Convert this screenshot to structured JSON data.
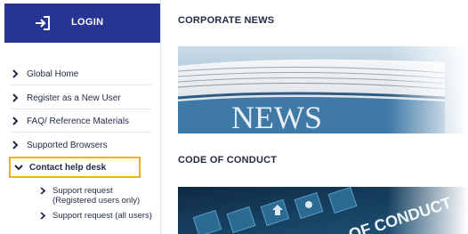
{
  "sidebar": {
    "login_label": "LOGIN",
    "items": [
      {
        "label": "Global Home"
      },
      {
        "label": "Register as a New User"
      },
      {
        "label": "FAQ/ Reference Materials"
      },
      {
        "label": "Supported Browsers"
      }
    ],
    "active_item": {
      "label": "Contact help desk"
    },
    "sub_items": [
      {
        "label": "Support request (Registered users only)"
      },
      {
        "label": "Support request (all users)"
      }
    ]
  },
  "main": {
    "sections": [
      {
        "title": "CORPORATE NEWS",
        "image_text": "NEWS"
      },
      {
        "title": "CODE OF CONDUCT",
        "image_text": "OF CONDUCT"
      }
    ]
  },
  "colors": {
    "login_bar": "#283593",
    "highlight_border": "#f3b400",
    "text": "#1f2a44"
  },
  "icons": {
    "login": "login-arrow-icon",
    "chevron_right": "chevron-right-icon",
    "chevron_down": "chevron-down-icon"
  }
}
